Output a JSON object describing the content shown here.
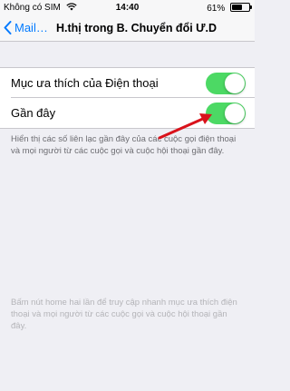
{
  "status_bar": {
    "carrier": "Không có SIM",
    "time": "14:40",
    "battery_percent": "61%",
    "battery_level": 0.61
  },
  "nav": {
    "back_label": "Mail…",
    "title": "H.thị trong B. Chuyển đổi Ư.D"
  },
  "settings": {
    "items": [
      {
        "label": "Mục ưa thích của Điện thoại",
        "enabled": true
      },
      {
        "label": "Gần đây",
        "enabled": true
      }
    ],
    "footer_note": "Hiển thị các số liên lạc gần đây của các cuộc gọi điện thoại và mọi người từ các cuộc gọi và cuộc hội thoại gần đây."
  },
  "help_text": "Bấm nút home hai lần để truy cập nhanh mục ưa thích điện thoại và mọi người từ các cuộc gọi và cuộc hội thoại gần đây.",
  "colors": {
    "accent": "#007aff",
    "toggle_on": "#4cd964",
    "annotation_arrow": "#d9121b"
  }
}
